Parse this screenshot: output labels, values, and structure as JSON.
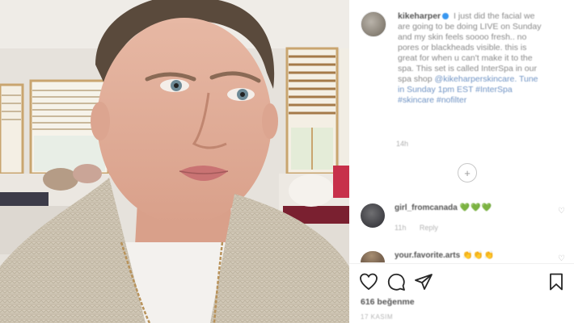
{
  "post": {
    "author": {
      "username": "kikeharper",
      "avatar_icon": "profile-photo"
    },
    "caption": {
      "text": "I just did the facial we are going to be doing LIVE on Sunday and my skin feels soooo fresh.. no pores or blackheads visible. this is great for when u can't make it to the spa. This set is called InterSpa in our spa shop",
      "link_text": "@kikeharperskincare. Tune in Sunday 1pm EST",
      "hashtags": "#InterSpa #skincare #nofilter"
    },
    "time_ago": "14h",
    "load_more_icon": "plus-circle-icon",
    "comments": [
      {
        "username": "girl_fromcanada",
        "text": "💚💚💚",
        "meta_time": "11h",
        "meta_reply": "Reply"
      },
      {
        "username": "your.favorite.arts",
        "text": "👏👏👏",
        "meta_time": "",
        "meta_reply": ""
      }
    ],
    "actions": {
      "like_icon": "heart-icon",
      "comment_icon": "comment-icon",
      "share_icon": "send-icon",
      "save_icon": "bookmark-icon"
    },
    "likes": "616 beğenme",
    "date": "17 KASIM"
  },
  "colors": {
    "accent_green": "#2eb72e",
    "link_blue": "#6f93c4",
    "verified_blue": "#3897f0"
  }
}
